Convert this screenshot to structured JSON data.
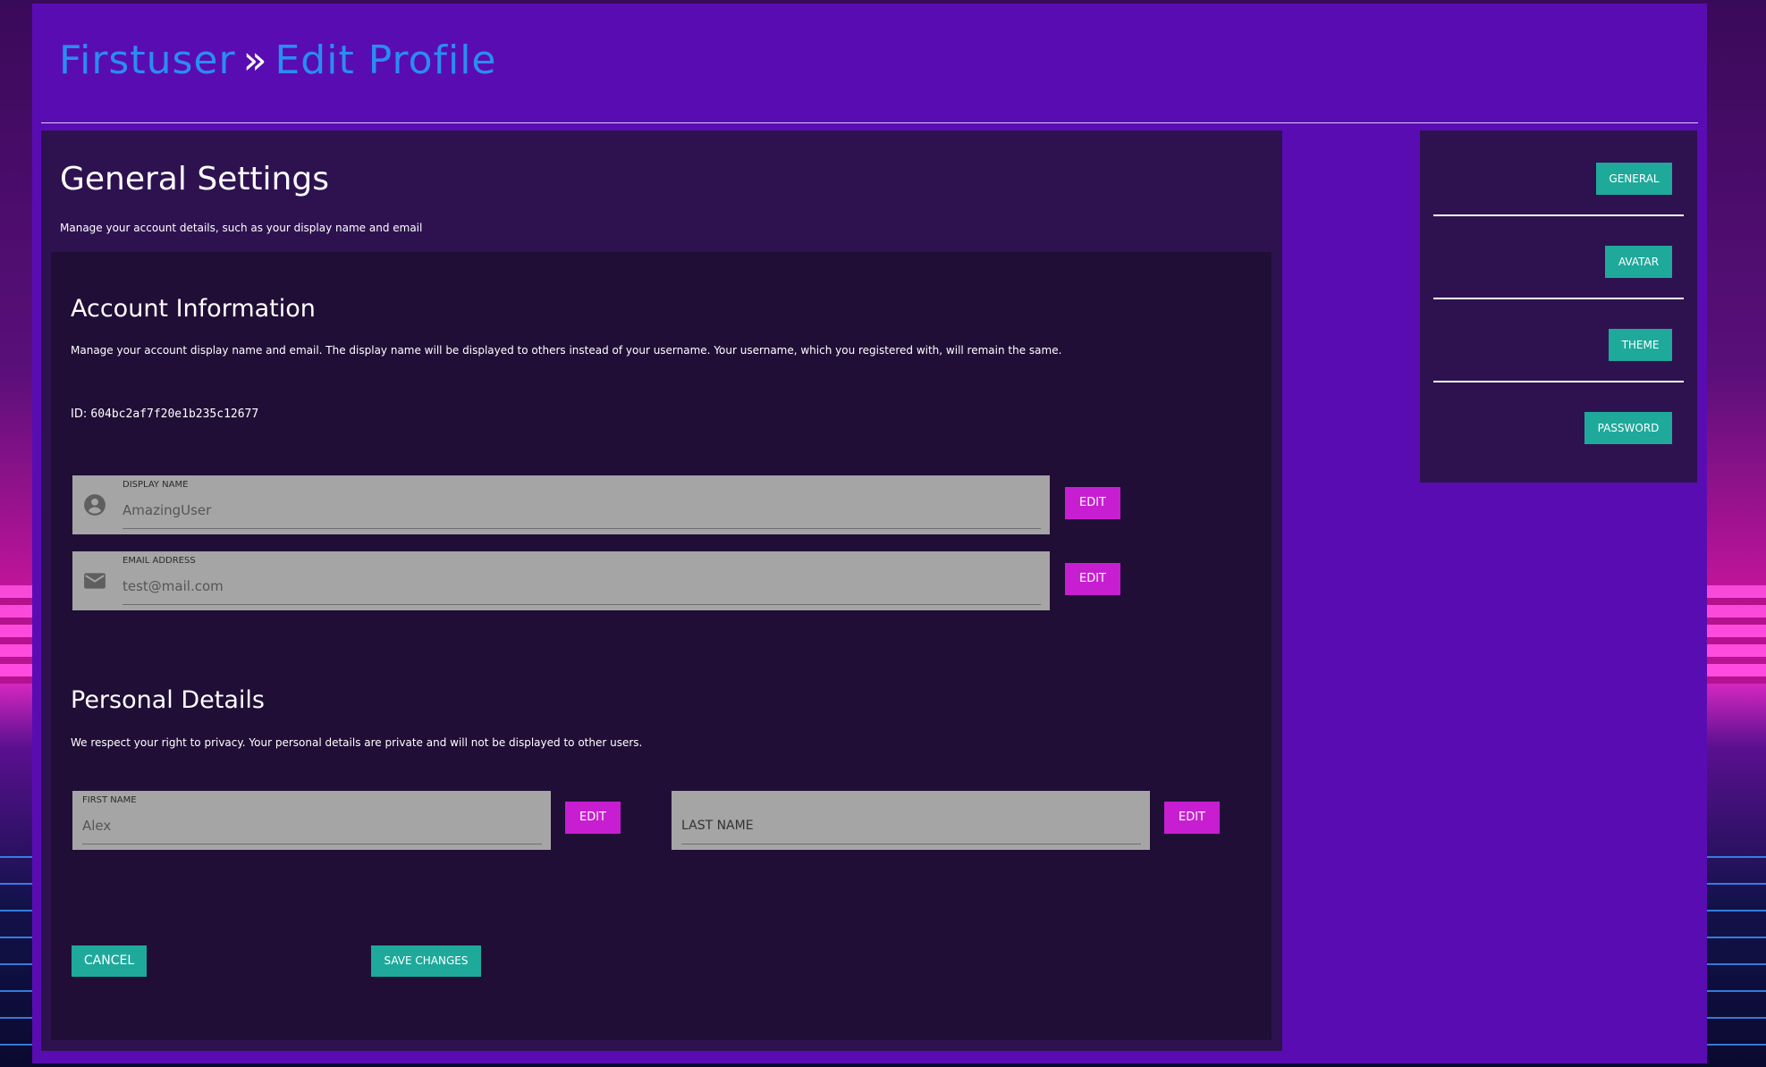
{
  "header": {
    "user": "Firstuser",
    "separator": "»",
    "page": "Edit Profile"
  },
  "main": {
    "title": "General Settings",
    "subtitle": "Manage your account details, such as your display name and email"
  },
  "account": {
    "title": "Account Information",
    "description": "Manage your account display name and email. The display name will be displayed to others instead of your username. Your username, which you registered with, will remain the same.",
    "id_label": "ID:",
    "id_value": "604bc2af7f20e1b235c12677",
    "display_name": {
      "label": "DISPLAY NAME",
      "placeholder": "AmazingUser",
      "icon": "account-circle-icon"
    },
    "email": {
      "label": "EMAIL ADDRESS",
      "placeholder": "test@mail.com",
      "icon": "mail-icon"
    },
    "edit_label": "EDIT"
  },
  "personal": {
    "title": "Personal Details",
    "description": "We respect your right to privacy. Your personal details are private and will not be displayed to other users.",
    "first_name": {
      "label": "FIRST NAME",
      "placeholder": "Alex"
    },
    "last_name": {
      "label": "LAST NAME"
    },
    "edit_label": "EDIT"
  },
  "actions": {
    "cancel": "CANCEL",
    "save": "SAVE CHANGES"
  },
  "sidebar": {
    "items": [
      {
        "label": "GENERAL"
      },
      {
        "label": "AVATAR"
      },
      {
        "label": "THEME"
      },
      {
        "label": "PASSWORD"
      }
    ]
  },
  "colors": {
    "frame": "#5a0cb3",
    "panel": "#2e1250",
    "inner": "#200e36",
    "title_link": "#2a8df0",
    "edit_button": "#c81ed2",
    "teal_button": "#1ea99b",
    "field": "#a5a5a5"
  }
}
